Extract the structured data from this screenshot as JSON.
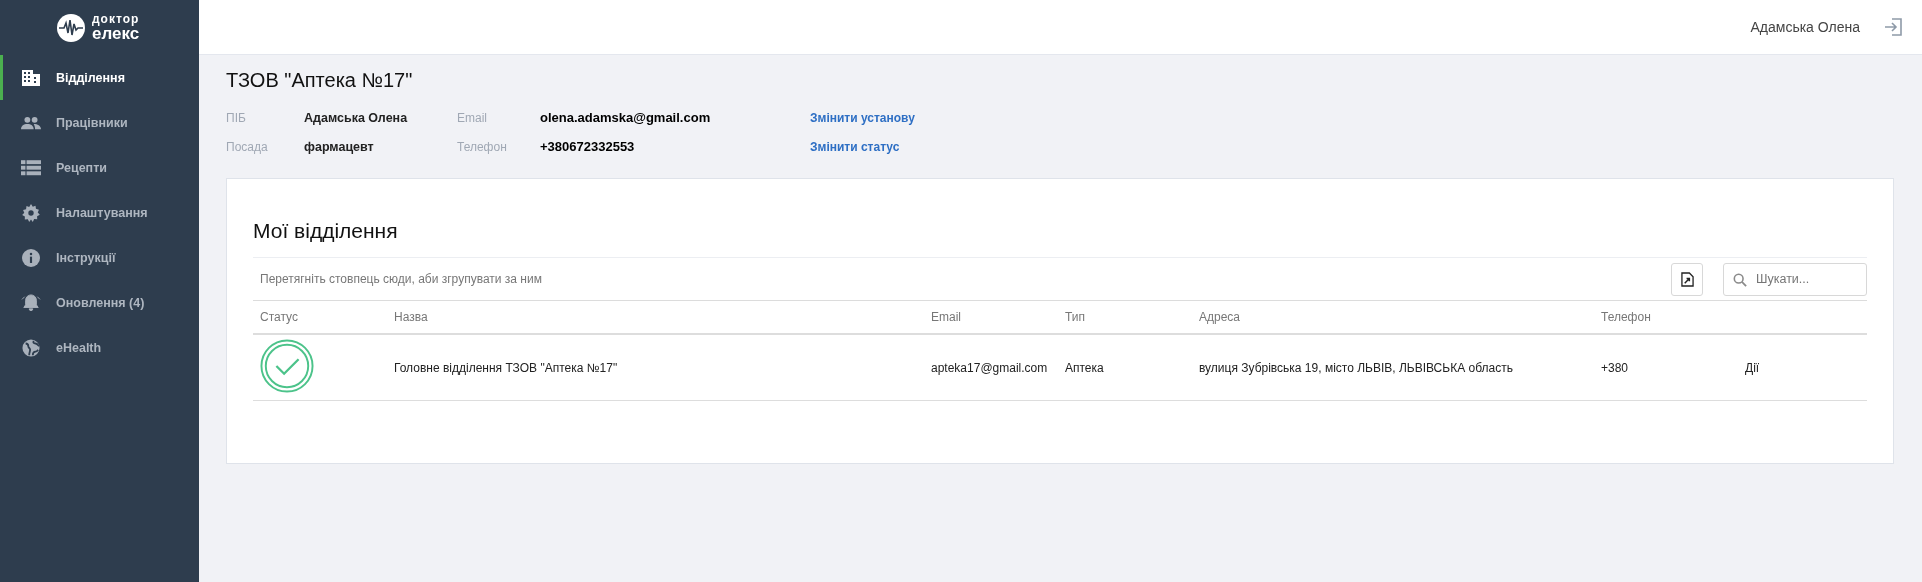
{
  "logo": {
    "line_1": "доктор",
    "line_2": "елекс"
  },
  "sidebar": {
    "items": [
      {
        "label": "Відділення",
        "kind": "building",
        "selected": true
      },
      {
        "label": "Працівники",
        "kind": "people",
        "selected": false
      },
      {
        "label": "Рецепти",
        "kind": "list",
        "selected": false
      },
      {
        "label": "Налаштування",
        "kind": "gear",
        "selected": false
      },
      {
        "label": "Інструкції",
        "kind": "info",
        "selected": false
      },
      {
        "label": "Оновлення (4)",
        "kind": "bell",
        "selected": false
      },
      {
        "label": "eHealth",
        "kind": "globe",
        "selected": false
      }
    ]
  },
  "header": {
    "user": "Адамська Олена"
  },
  "organization": {
    "title": "ТЗОВ \"Аптека №17\"",
    "fields": [
      {
        "label": "ПІБ",
        "value": "Адамська Олена"
      },
      {
        "label": "Email",
        "value": "olena.adamska@gmail.com"
      },
      {
        "label": "Посада",
        "value": "фармацевт"
      },
      {
        "label": "Телефон",
        "value": "+380672332553"
      }
    ],
    "links": [
      "Змінити установу",
      "Змінити статус"
    ]
  },
  "departments": {
    "title": "Мої відділення",
    "group_hint": "Перетягніть стовпець сюди, аби згрупувати за ним",
    "search": {
      "placeholder": "Шукати..."
    },
    "columns": [
      "Статус",
      "Назва",
      "Email",
      "Тип",
      "Адреса",
      "Телефон"
    ],
    "rows": [
      {
        "active": true,
        "name": "Головне відділення ТЗОВ \"Аптека №17\"",
        "email": "apteka17@gmail.com",
        "type": "Аптека",
        "address": "вулиця Зубрівська 19, місто ЛЬВІВ, ЛЬВІВСЬКА область",
        "phone": "+380",
        "action": "Дії"
      }
    ]
  }
}
